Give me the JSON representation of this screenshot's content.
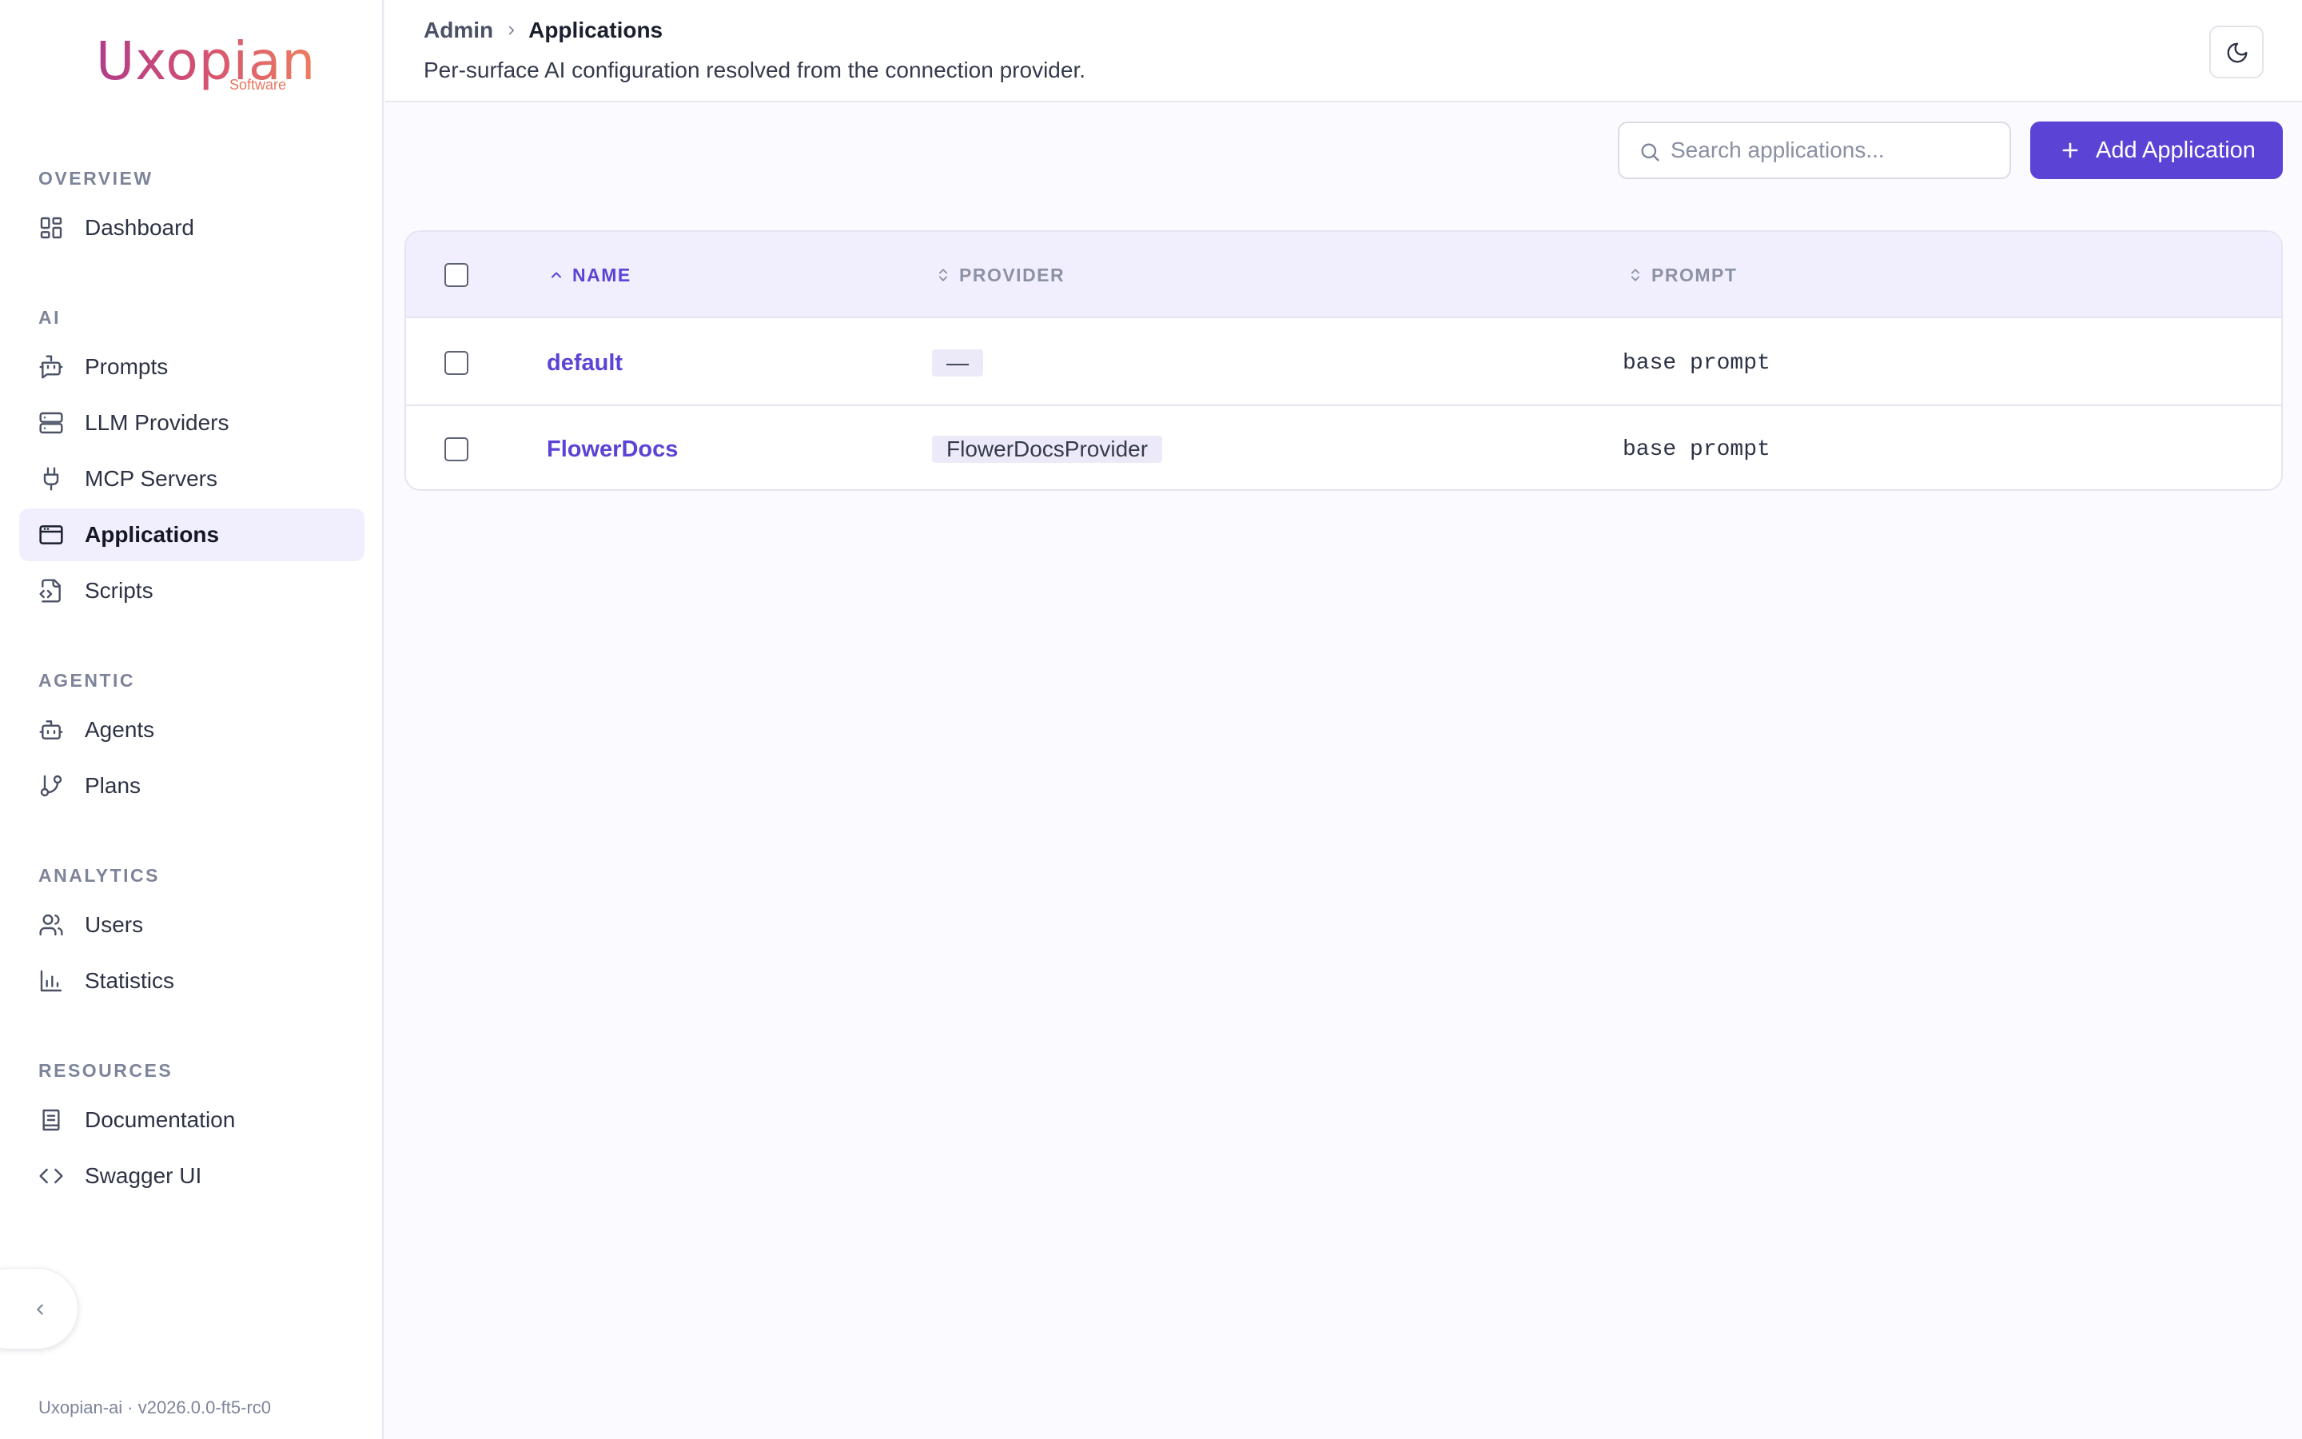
{
  "logo": {
    "word": "Uxopian",
    "sub": "Software"
  },
  "sidebar": {
    "sections": [
      {
        "title": "OVERVIEW",
        "items": [
          {
            "label": "Dashboard",
            "icon": "dashboard-icon"
          }
        ]
      },
      {
        "title": "AI",
        "items": [
          {
            "label": "Prompts",
            "icon": "bot-message-icon"
          },
          {
            "label": "LLM Providers",
            "icon": "server-icon"
          },
          {
            "label": "MCP Servers",
            "icon": "plug-icon"
          },
          {
            "label": "Applications",
            "icon": "app-window-icon",
            "active": true
          },
          {
            "label": "Scripts",
            "icon": "file-code-icon"
          }
        ]
      },
      {
        "title": "AGENTIC",
        "items": [
          {
            "label": "Agents",
            "icon": "bot-icon"
          },
          {
            "label": "Plans",
            "icon": "git-branch-icon"
          }
        ]
      },
      {
        "title": "ANALYTICS",
        "items": [
          {
            "label": "Users",
            "icon": "users-icon"
          },
          {
            "label": "Statistics",
            "icon": "bar-chart-icon"
          }
        ]
      },
      {
        "title": "RESOURCES",
        "items": [
          {
            "label": "Documentation",
            "icon": "book-icon"
          },
          {
            "label": "Swagger UI",
            "icon": "code-icon"
          }
        ]
      }
    ],
    "version": "Uxopian-ai · v2026.0.0-ft5-rc0"
  },
  "header": {
    "breadcrumb_root": "Admin",
    "breadcrumb_current": "Applications",
    "subtitle": "Per-surface AI configuration resolved from the connection provider."
  },
  "toolbar": {
    "search_placeholder": "Search applications...",
    "search_value": "",
    "add_label": "Add Application"
  },
  "table": {
    "columns": [
      "NAME",
      "PROVIDER",
      "PROMPT"
    ],
    "sorted_column": "NAME",
    "rows": [
      {
        "name": "default",
        "provider": "—",
        "prompt": "base prompt"
      },
      {
        "name": "FlowerDocs",
        "provider": "FlowerDocsProvider",
        "prompt": "base prompt"
      }
    ]
  },
  "colors": {
    "accent": "#5b43d6",
    "active_bg": "#f1effd"
  }
}
